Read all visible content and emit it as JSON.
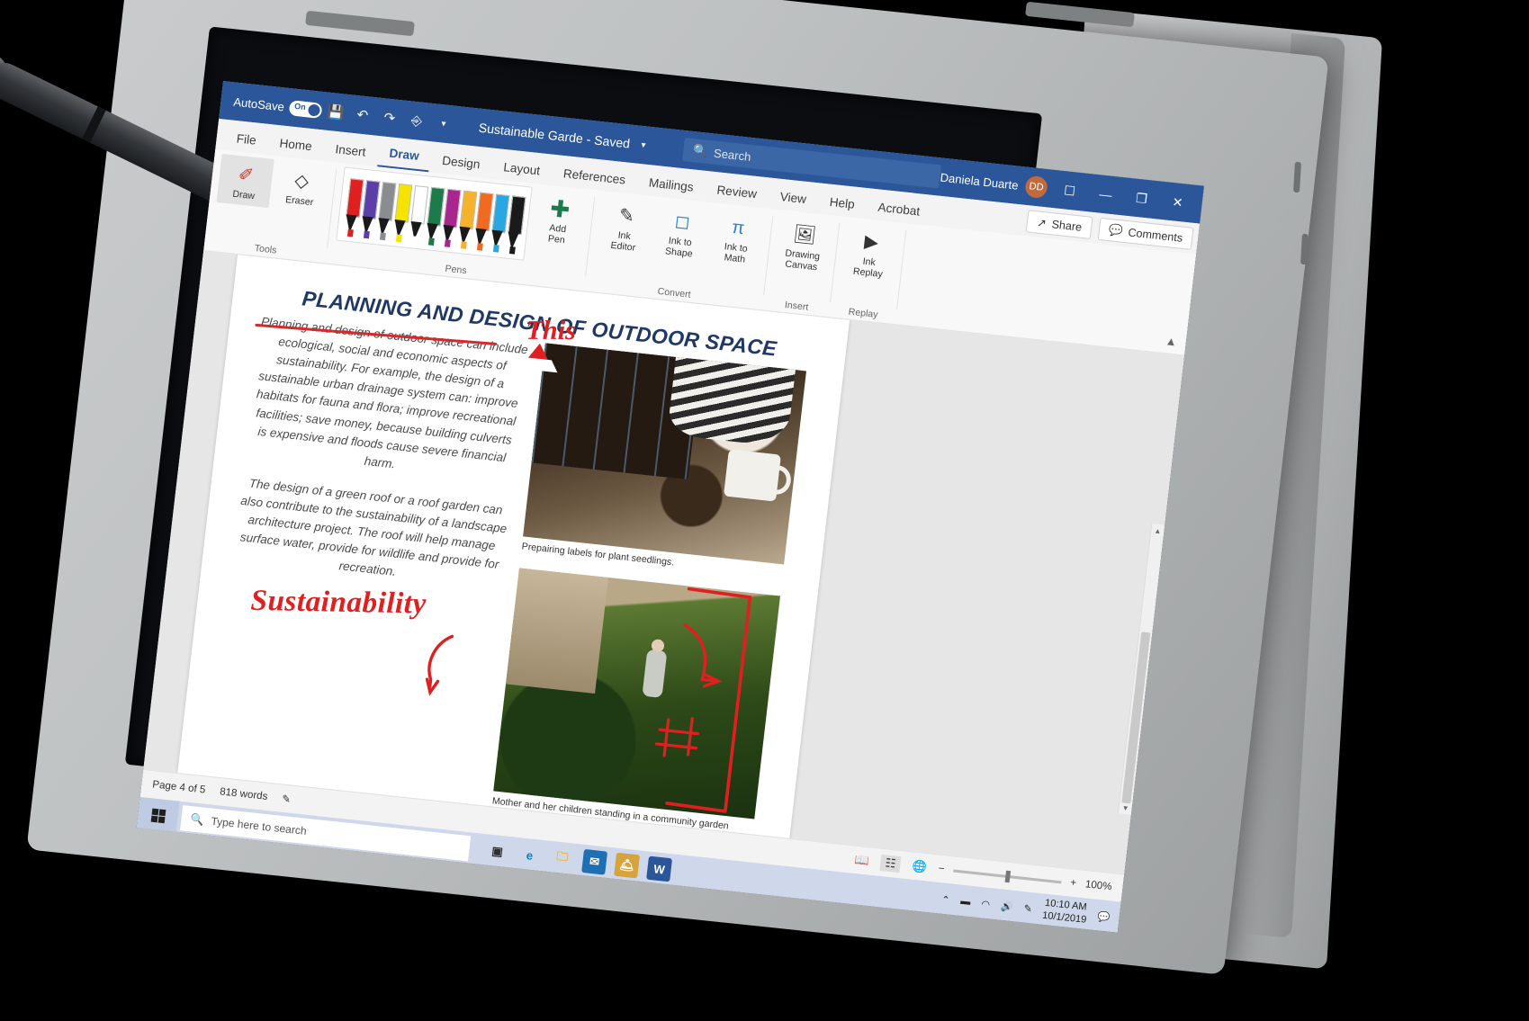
{
  "titlebar": {
    "autosave_label": "AutoSave",
    "autosave_state": "On",
    "save_icon": "save-icon",
    "undo_icon": "undo-icon",
    "redo_icon": "redo-icon",
    "touch_icon": "touch-mode-icon",
    "customize_icon": "chevron-down-icon",
    "doc_title": "Sustainable Garde  -  Saved",
    "doc_dropdown_icon": "chevron-down-icon",
    "search_placeholder": "Search",
    "search_icon": "search-icon",
    "user_name": "Daniela Duarte",
    "user_initials": "DD",
    "ribbon_display_icon": "ribbon-display-options-icon",
    "minimize": "—",
    "restore": "❐",
    "close": "✕"
  },
  "tabs": [
    {
      "label": "File",
      "active": false
    },
    {
      "label": "Home",
      "active": false
    },
    {
      "label": "Insert",
      "active": false
    },
    {
      "label": "Draw",
      "active": true
    },
    {
      "label": "Design",
      "active": false
    },
    {
      "label": "Layout",
      "active": false
    },
    {
      "label": "References",
      "active": false
    },
    {
      "label": "Mailings",
      "active": false
    },
    {
      "label": "Review",
      "active": false
    },
    {
      "label": "View",
      "active": false
    },
    {
      "label": "Help",
      "active": false
    },
    {
      "label": "Acrobat",
      "active": false
    }
  ],
  "tab_right": {
    "share_label": "Share",
    "share_icon": "share-icon",
    "comments_label": "Comments",
    "comments_icon": "comment-icon"
  },
  "ribbon": {
    "collapse_icon": "chevron-up-icon",
    "groups": [
      {
        "name": "Tools",
        "label": "Tools",
        "buttons": [
          {
            "label": "Draw",
            "icon": "draw-pen-icon",
            "selected": true
          },
          {
            "label": "Eraser",
            "icon": "eraser-icon",
            "selected": false
          }
        ]
      },
      {
        "name": "Pens",
        "label": "Pens",
        "pens": [
          {
            "name": "pen-red",
            "color": "#e02020"
          },
          {
            "name": "pen-rainbow",
            "color": "#5b3fa8"
          },
          {
            "name": "pen-gray",
            "color": "#8a8d90"
          },
          {
            "name": "pen-yellow-highlighter",
            "color": "#f5e400"
          },
          {
            "name": "pen-white",
            "color": "#ffffff"
          },
          {
            "name": "pen-green",
            "color": "#1d7a4a"
          },
          {
            "name": "pen-magenta",
            "color": "#a9268f"
          },
          {
            "name": "pen-gold",
            "color": "#f5b22b"
          },
          {
            "name": "pen-orange",
            "color": "#f26a20"
          },
          {
            "name": "pen-blue",
            "color": "#2aa6e0"
          },
          {
            "name": "pen-black",
            "color": "#1a1a1a"
          }
        ],
        "add_pen_label": "Add\nPen",
        "add_pen_icon": "plus-icon"
      },
      {
        "name": "Convert",
        "label": "Convert",
        "buttons": [
          {
            "label": "Ink\nEditor",
            "icon": "ink-editor-icon",
            "selected": false
          },
          {
            "label": "Ink to\nShape",
            "icon": "ink-to-shape-icon",
            "selected": false
          },
          {
            "label": "Ink to\nMath",
            "icon": "ink-to-math-icon",
            "selected": false
          }
        ]
      },
      {
        "name": "Insert",
        "label": "Insert",
        "buttons": [
          {
            "label": "Drawing\nCanvas",
            "icon": "drawing-canvas-icon",
            "selected": false
          }
        ]
      },
      {
        "name": "Replay",
        "label": "Replay",
        "buttons": [
          {
            "label": "Ink\nReplay",
            "icon": "ink-replay-icon",
            "selected": false
          }
        ]
      }
    ]
  },
  "document": {
    "heading": "PLANNING AND DESIGN OF OUTDOOR SPACE",
    "paragraph_1": "Planning and design of outdoor space can include ecological, social and economic aspects of sustainability. For example, the design of a sustainable urban drainage system can: improve habitats for fauna and flora; improve recreational facilities; save money, because building culverts is expensive and floods cause severe financial harm.",
    "paragraph_2": "The design of a green roof or a roof garden can also contribute to the sustainability of a landscape architecture project. The roof will help manage surface water, provide for wildlife and provide for recreation.",
    "caption_1": "Prepairing labels for plant seedlings.",
    "caption_2": "Mother and her children standing in a community garden project.",
    "ink_annotations": [
      {
        "name": "ink-word-this",
        "text": "This",
        "color": "#e02020"
      },
      {
        "name": "ink-word-sustainability",
        "text": "Sustainability",
        "color": "#e02020"
      },
      {
        "name": "ink-strikethrough",
        "text": "",
        "color": "#e02020"
      },
      {
        "name": "ink-caret-mark",
        "text": "",
        "color": "#e02020"
      },
      {
        "name": "ink-bracket-shape",
        "text": "",
        "color": "#e02020"
      },
      {
        "name": "ink-arrow-down-left",
        "text": "",
        "color": "#e02020"
      },
      {
        "name": "ink-arrow-right",
        "text": "",
        "color": "#e02020"
      },
      {
        "name": "ink-crop-square",
        "text": "",
        "color": "#e02020"
      }
    ]
  },
  "statusbar": {
    "page_label": "Page 4 of 5",
    "word_count": "818 words",
    "proofing_icon": "proofing-errors-icon",
    "view_read_icon": "read-mode-icon",
    "view_print_icon": "print-layout-icon",
    "view_web_icon": "web-layout-icon",
    "zoom_out": "−",
    "zoom_in": "+",
    "zoom_level": "100%"
  },
  "taskbar": {
    "start_icon": "windows-start-icon",
    "search_placeholder": "Type here to search",
    "search_icon": "search-icon",
    "items": [
      {
        "name": "task-view-icon",
        "glyph": "▣",
        "color": "#2f2f2f",
        "bg": "transparent"
      },
      {
        "name": "edge-browser-icon",
        "glyph": "e",
        "color": "#0b7ec4",
        "bg": "transparent"
      },
      {
        "name": "file-explorer-icon",
        "glyph": "🗀",
        "color": "#f2b134",
        "bg": "transparent"
      },
      {
        "name": "mail-icon",
        "glyph": "✉",
        "color": "#ffffff",
        "bg": "#1f6fb5"
      },
      {
        "name": "microsoft-store-icon",
        "glyph": "🛎",
        "color": "#ffffff",
        "bg": "#d6a43c"
      },
      {
        "name": "word-app-icon",
        "glyph": "W",
        "color": "#ffffff",
        "bg": "#2b579a"
      }
    ],
    "tray": [
      {
        "name": "show-hidden-icons-icon",
        "glyph": "⌃"
      },
      {
        "name": "battery-icon",
        "glyph": "▬"
      },
      {
        "name": "wifi-icon",
        "glyph": "◠"
      },
      {
        "name": "volume-icon",
        "glyph": "🔊"
      },
      {
        "name": "pen-menu-icon",
        "glyph": "✎"
      }
    ],
    "time": "10:10 AM",
    "date": "10/1/2019",
    "action_center_icon": "notifications-icon"
  },
  "colors": {
    "word_blue": "#2b579a",
    "ink_red": "#e02020",
    "heading_navy": "#1f3864",
    "taskbar_blue": "#cfd8ea"
  }
}
